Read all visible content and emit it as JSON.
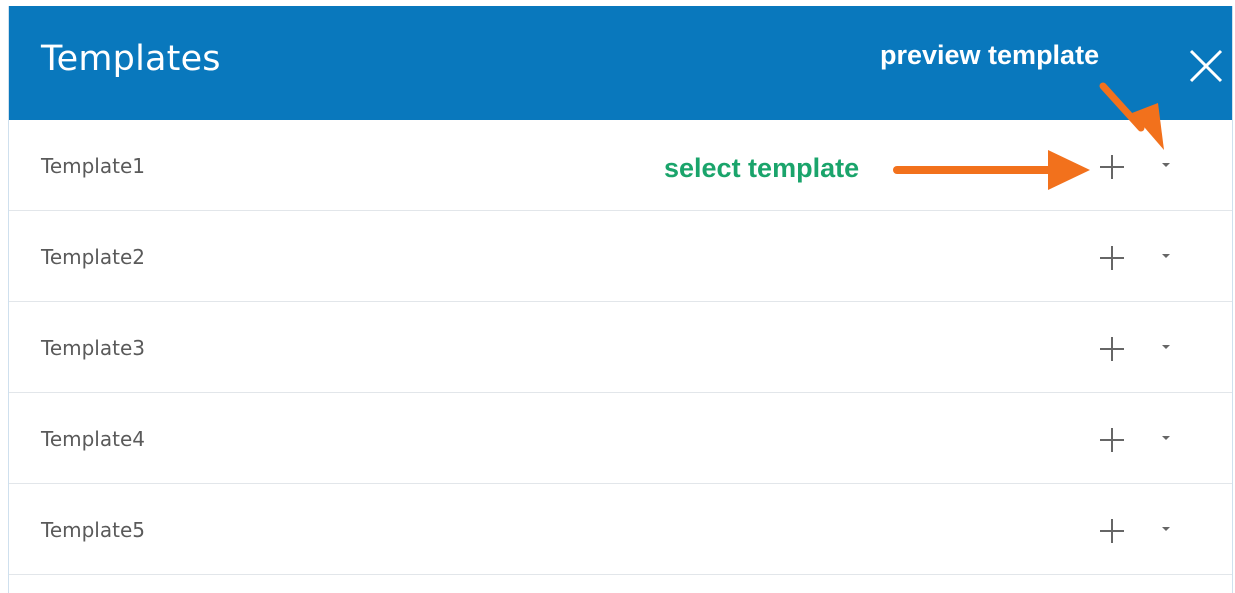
{
  "header": {
    "title": "Templates",
    "close_icon": "close-icon",
    "background_color": "#0978bd"
  },
  "templates": [
    {
      "label": "Template1"
    },
    {
      "label": "Template2"
    },
    {
      "label": "Template3"
    },
    {
      "label": "Template4"
    },
    {
      "label": "Template5"
    }
  ],
  "row_icons": {
    "add": "plus-icon",
    "preview": "caret-down-icon"
  },
  "annotations": {
    "preview_label": "preview template",
    "select_label": "select template",
    "arrow_color": "#f2711c",
    "select_label_color": "#1aa46b"
  }
}
